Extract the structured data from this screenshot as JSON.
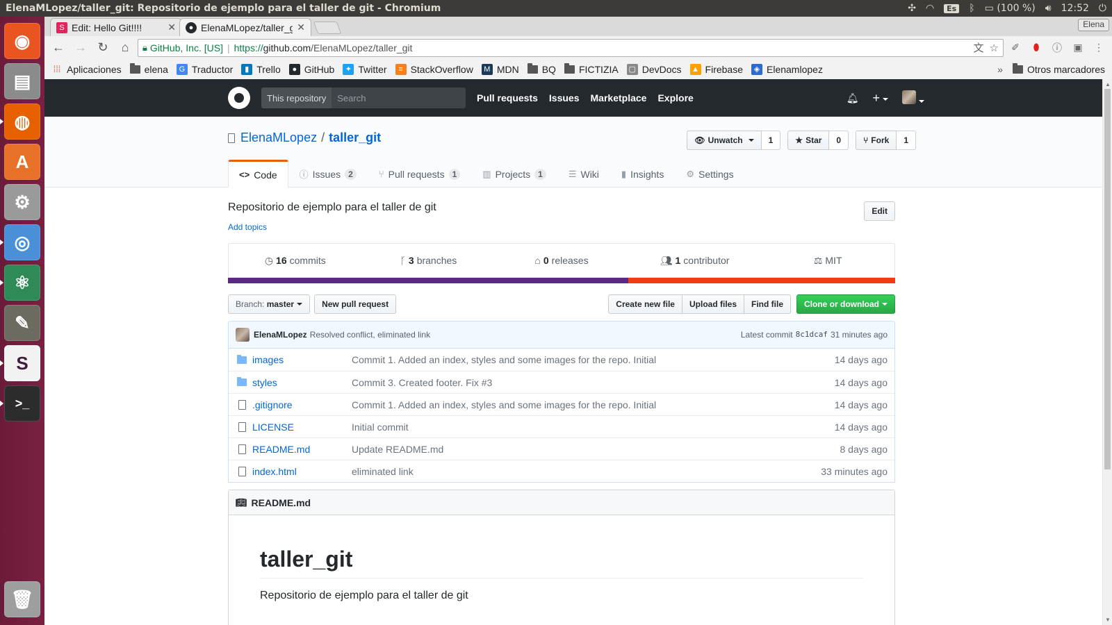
{
  "os": {
    "window_title": "ElenaMLopez/taller_git: Repositorio de ejemplo para el taller de git - Chromium",
    "keyboard": "Es",
    "battery": "(100 %)",
    "clock": "12:52"
  },
  "browser": {
    "tabs": [
      {
        "title": "Edit: Hello Git!!!!",
        "favicon_color": "#e0245e"
      },
      {
        "title": "ElenaMLopez/taller_git",
        "favicon_color": "#24292e"
      }
    ],
    "profile": "Elena",
    "omnibox": {
      "org": "GitHub, Inc. [US]",
      "scheme": "https://",
      "host": "github.com",
      "path": "/ElenaMLopez/taller_git"
    },
    "bookmarks": [
      {
        "label": "Aplicaciones",
        "kind": "apps"
      },
      {
        "label": "elena",
        "kind": "folder"
      },
      {
        "label": "Traductor",
        "kind": "translate"
      },
      {
        "label": "Trello",
        "kind": "trello"
      },
      {
        "label": "GitHub",
        "kind": "github"
      },
      {
        "label": "Twitter",
        "kind": "twitter"
      },
      {
        "label": "StackOverflow",
        "kind": "stackoverflow"
      },
      {
        "label": "MDN",
        "kind": "mdn"
      },
      {
        "label": "BQ",
        "kind": "folder"
      },
      {
        "label": "FICTIZIA",
        "kind": "folder"
      },
      {
        "label": "DevDocs",
        "kind": "devdocs"
      },
      {
        "label": "Firebase",
        "kind": "firebase"
      },
      {
        "label": "Elenamlopez",
        "kind": "site"
      }
    ],
    "bookmarks_more": "»",
    "other_bookmarks": "Otros marcadores"
  },
  "github": {
    "search_scope": "This repository",
    "search_placeholder": "Search",
    "nav": [
      "Pull requests",
      "Issues",
      "Marketplace",
      "Explore"
    ],
    "owner": "ElenaMLopez",
    "repo": "taller_git",
    "actions": {
      "watch_label": "Unwatch",
      "watch_count": "1",
      "star_label": "Star",
      "star_count": "0",
      "fork_label": "Fork",
      "fork_count": "1"
    },
    "tabs": [
      {
        "label": "Code",
        "icon": "<>",
        "counter": ""
      },
      {
        "label": "Issues",
        "icon": "ⓘ",
        "counter": "2"
      },
      {
        "label": "Pull requests",
        "icon": "⑂",
        "counter": "1"
      },
      {
        "label": "Projects",
        "icon": "▥",
        "counter": "1"
      },
      {
        "label": "Wiki",
        "icon": "☰",
        "counter": ""
      },
      {
        "label": "Insights",
        "icon": "▮",
        "counter": ""
      },
      {
        "label": "Settings",
        "icon": "⚙",
        "counter": ""
      }
    ],
    "description": "Repositorio de ejemplo para el taller de git",
    "add_topics": "Add topics",
    "edit_label": "Edit",
    "summary": {
      "commits_num": "16",
      "commits_label": "commits",
      "branches_num": "3",
      "branches_label": "branches",
      "releases_num": "0",
      "releases_label": "releases",
      "contributors_num": "1",
      "contributors_label": "contributor",
      "license": "MIT"
    },
    "language_fractions": {
      "html": 0.6,
      "css": 0.4
    },
    "language_colors": {
      "html": "#5a2a82",
      "css": "#f03c12"
    },
    "branch_prefix": "Branch:",
    "branch_name": "master",
    "new_pr": "New pull request",
    "create_file": "Create new file",
    "upload_files": "Upload files",
    "find_file": "Find file",
    "clone": "Clone or download",
    "latest_commit": {
      "author": "ElenaMLopez",
      "message": "Resolved conflict, eliminated link",
      "prefix": "Latest commit",
      "sha": "8c1dcaf",
      "age": "31 minutes ago"
    },
    "files": [
      {
        "name": "images",
        "type": "dir",
        "message": "Commit 1. Added an index, styles and some images for the repo. Initial",
        "age": "14 days ago"
      },
      {
        "name": "styles",
        "type": "dir",
        "message": "Commit 3. Created footer. Fix #3",
        "age": "14 days ago"
      },
      {
        "name": ".gitignore",
        "type": "file",
        "message": "Commit 1. Added an index, styles and some images for the repo. Initial",
        "age": "14 days ago"
      },
      {
        "name": "LICENSE",
        "type": "file",
        "message": "Initial commit",
        "age": "14 days ago"
      },
      {
        "name": "README.md",
        "type": "file",
        "message": "Update README.md",
        "age": "8 days ago"
      },
      {
        "name": "index.html",
        "type": "file",
        "message": "eliminated link",
        "age": "33 minutes ago"
      }
    ],
    "readme": {
      "filename": "README.md",
      "heading": "taller_git",
      "body": "Repositorio de ejemplo para el taller de git"
    }
  },
  "launcher": [
    {
      "name": "ubuntu-dash-icon",
      "glyph": "◉",
      "bg": "#e95420"
    },
    {
      "name": "files-icon",
      "glyph": "▤",
      "bg": "#8b8b8b"
    },
    {
      "name": "firefox-icon",
      "glyph": "◍",
      "bg": "#e66000"
    },
    {
      "name": "software-center-icon",
      "glyph": "A",
      "bg": "#e8712a"
    },
    {
      "name": "system-settings-icon",
      "glyph": "⚙",
      "bg": "#9a9a9a"
    },
    {
      "name": "chromium-icon",
      "glyph": "◎",
      "bg": "#4a90d9"
    },
    {
      "name": "atom-icon",
      "glyph": "⚛",
      "bg": "#2e8b57"
    },
    {
      "name": "gimp-icon",
      "glyph": "✎",
      "bg": "#6d6a60"
    },
    {
      "name": "slack-icon",
      "glyph": "S",
      "bg": "#f2f2f2"
    },
    {
      "name": "terminal-icon",
      "glyph": ">_",
      "bg": "#2c2c2c"
    }
  ]
}
